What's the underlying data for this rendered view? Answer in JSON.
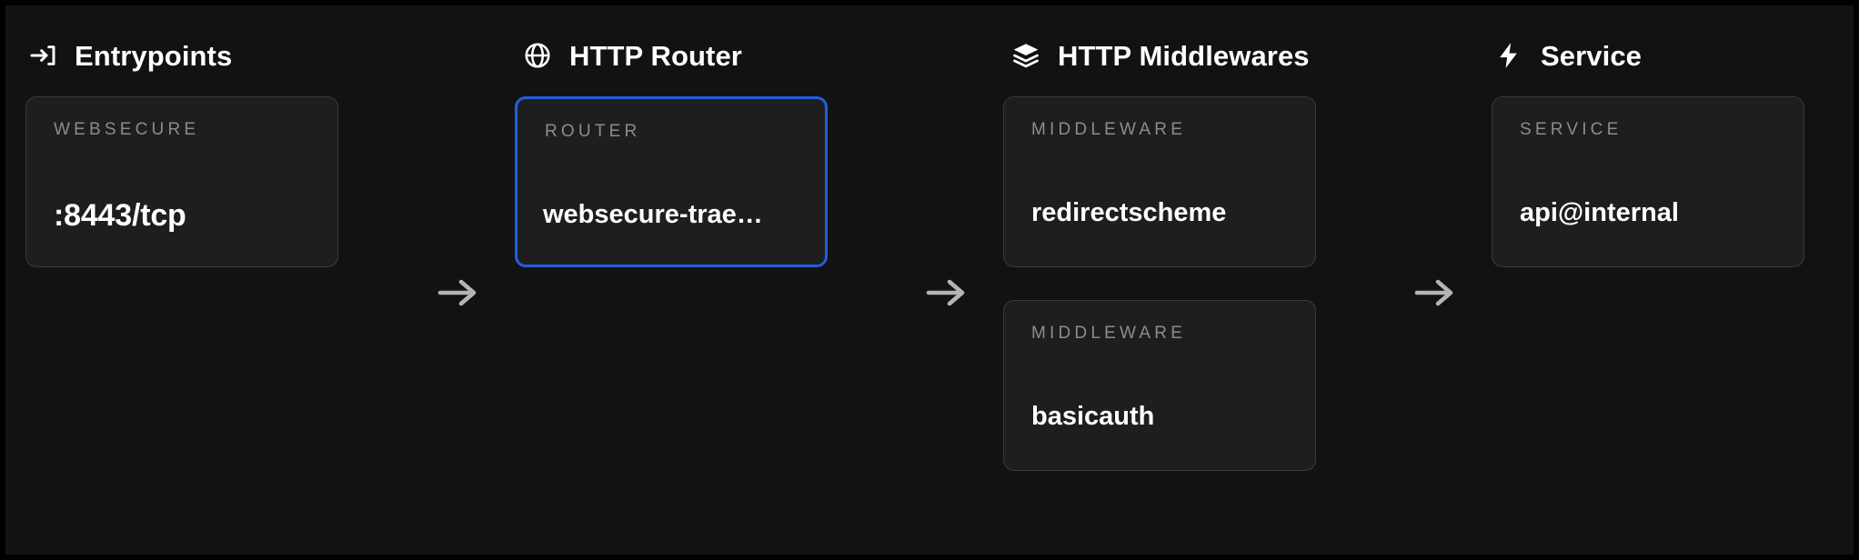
{
  "theme": {
    "page_background": "#121212",
    "card_background": "#1e1e1e",
    "card_border": "#3a3a3a",
    "selected_border": "#1f5fe0",
    "label_text": "#8c8c8c",
    "value_text": "#ffffff",
    "arrow_color": "#b4b4b4"
  },
  "columns": [
    {
      "id": "entrypoints",
      "icon": "login-arrow-icon",
      "title": "Entrypoints",
      "cards": [
        {
          "kind": "WEBSECURE",
          "value": ":8443/tcp",
          "selected": false,
          "truncated": false
        }
      ]
    },
    {
      "id": "http-router",
      "icon": "globe-icon",
      "title": "HTTP Router",
      "cards": [
        {
          "kind": "ROUTER",
          "value": "websecure-trae…",
          "selected": true,
          "truncated": true
        }
      ]
    },
    {
      "id": "http-middlewares",
      "icon": "layers-icon",
      "title": "HTTP Middlewares",
      "cards": [
        {
          "kind": "MIDDLEWARE",
          "value": "redirectscheme",
          "selected": false,
          "truncated": false
        },
        {
          "kind": "MIDDLEWARE",
          "value": "basicauth",
          "selected": false,
          "truncated": false
        }
      ]
    },
    {
      "id": "service",
      "icon": "lightning-bolt-icon",
      "title": "Service",
      "cards": [
        {
          "kind": "SERVICE",
          "value": "api@internal",
          "selected": false,
          "truncated": false
        }
      ]
    }
  ],
  "connectors": [
    {
      "id": "arrow-entrypoints-to-router",
      "icon": "arrow-right-icon"
    },
    {
      "id": "arrow-router-to-middlewares",
      "icon": "arrow-right-icon"
    },
    {
      "id": "arrow-middlewares-to-service",
      "icon": "arrow-right-icon"
    }
  ]
}
